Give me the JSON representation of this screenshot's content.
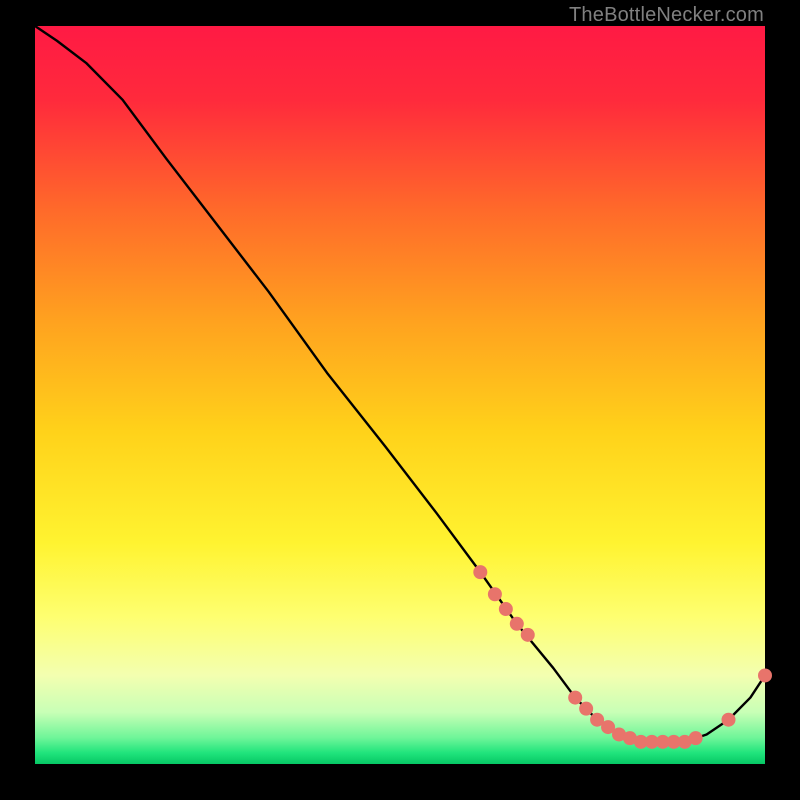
{
  "attribution": "TheBottleNecker.com",
  "chart_data": {
    "type": "line",
    "title": "",
    "xlabel": "",
    "ylabel": "",
    "xlim": [
      0,
      100
    ],
    "ylim": [
      0,
      100
    ],
    "x": [
      0,
      3,
      7,
      12,
      18,
      25,
      32,
      40,
      48,
      55,
      61,
      66,
      71,
      74,
      77,
      80,
      83,
      86,
      89,
      92,
      95,
      98,
      100
    ],
    "y": [
      100,
      98,
      95,
      90,
      82,
      73,
      64,
      53,
      43,
      34,
      26,
      19,
      13,
      9,
      6,
      4,
      3,
      3,
      3,
      4,
      6,
      9,
      12
    ],
    "markers": {
      "x": [
        61,
        63,
        64.5,
        66,
        67.5,
        74,
        75.5,
        77,
        78.5,
        80,
        81.5,
        83,
        84.5,
        86,
        87.5,
        89,
        90.5,
        95,
        100
      ],
      "y": [
        26,
        23,
        21,
        19,
        17.5,
        9,
        7.5,
        6,
        5,
        4,
        3.5,
        3,
        3,
        3,
        3,
        3,
        3.5,
        6,
        12
      ]
    },
    "gradient_stops": [
      {
        "offset": 0.0,
        "color": "#ff1a44"
      },
      {
        "offset": 0.1,
        "color": "#ff2a3c"
      },
      {
        "offset": 0.25,
        "color": "#ff6a2a"
      },
      {
        "offset": 0.4,
        "color": "#ffa21f"
      },
      {
        "offset": 0.55,
        "color": "#ffd21a"
      },
      {
        "offset": 0.7,
        "color": "#fff330"
      },
      {
        "offset": 0.8,
        "color": "#feff70"
      },
      {
        "offset": 0.88,
        "color": "#f3ffb0"
      },
      {
        "offset": 0.93,
        "color": "#c8ffb6"
      },
      {
        "offset": 0.965,
        "color": "#6df598"
      },
      {
        "offset": 0.985,
        "color": "#20e47c"
      },
      {
        "offset": 1.0,
        "color": "#06c765"
      }
    ],
    "curve_color": "#000000",
    "marker_color": "#e8746b",
    "marker_radius_px": 7
  }
}
